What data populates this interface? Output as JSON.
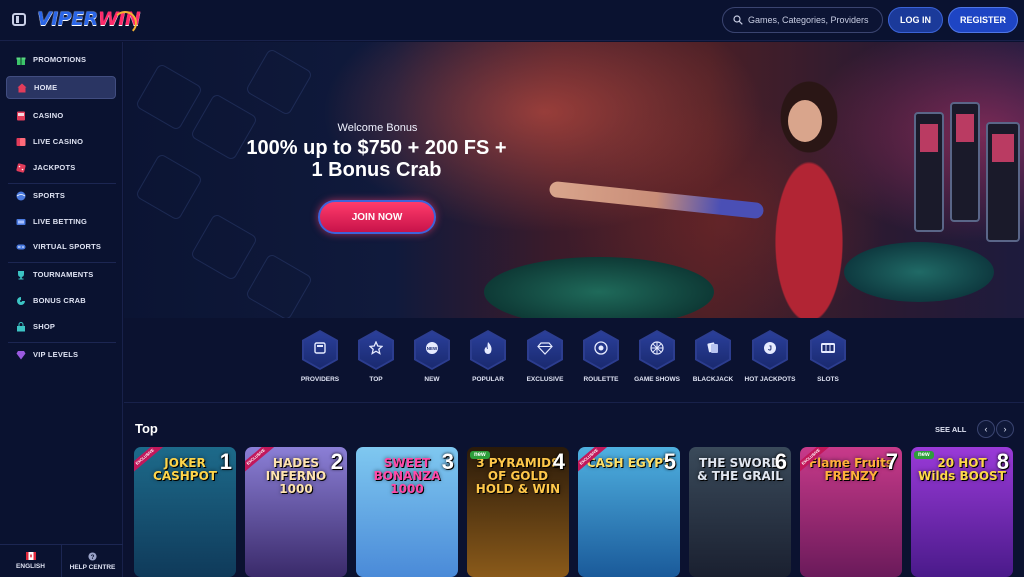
{
  "header": {
    "logo_part1": "VIPER",
    "logo_part2": "WIN",
    "search_placeholder": "Games, Categories, Providers",
    "login_label": "LOG IN",
    "register_label": "REGISTER"
  },
  "sidebar": {
    "items": [
      {
        "label": "PROMOTIONS",
        "icon": "gift-icon"
      },
      {
        "label": "HOME",
        "icon": "home-icon",
        "active": true
      },
      {
        "label": "CASINO",
        "icon": "slot-machine-icon"
      },
      {
        "label": "LIVE CASINO",
        "icon": "cards-icon"
      },
      {
        "label": "JACKPOTS",
        "icon": "dice-icon"
      },
      {
        "label": "SPORTS",
        "icon": "ball-icon"
      },
      {
        "label": "LIVE BETTING",
        "icon": "live-icon"
      },
      {
        "label": "VIRTUAL SPORTS",
        "icon": "gamepad-icon"
      },
      {
        "label": "TOURNAMENTS",
        "icon": "trophy-icon"
      },
      {
        "label": "BONUS CRAB",
        "icon": "crab-icon"
      },
      {
        "label": "SHOP",
        "icon": "shop-icon"
      },
      {
        "label": "VIP LEVELS",
        "icon": "diamond-icon"
      }
    ],
    "language_label": "ENGLISH",
    "help_label": "HELP CENTRE"
  },
  "hero": {
    "subtitle": "Welcome Bonus",
    "title": "100% up to $750 + 200 FS + 1 Bonus Crab",
    "cta_label": "JOIN NOW"
  },
  "categories": [
    {
      "label": "PROVIDERS",
      "icon": "providers-icon"
    },
    {
      "label": "TOP",
      "icon": "star-icon"
    },
    {
      "label": "NEW",
      "icon": "new-icon"
    },
    {
      "label": "POPULAR",
      "icon": "fire-icon"
    },
    {
      "label": "EXCLUSIVE",
      "icon": "diamond-icon"
    },
    {
      "label": "ROULETTE",
      "icon": "roulette-icon"
    },
    {
      "label": "GAME SHOWS",
      "icon": "wheel-icon"
    },
    {
      "label": "BLACKJACK",
      "icon": "blackjack-icon"
    },
    {
      "label": "HOT JACKPOTS",
      "icon": "jackpot-icon"
    },
    {
      "label": "SLOTS",
      "icon": "slots-icon"
    }
  ],
  "top_section": {
    "title": "Top",
    "see_all_label": "SEE ALL",
    "games": [
      {
        "rank": "1",
        "title": "JOKER CASHPOT",
        "ribbon": "EXCLUSIVE",
        "colors": [
          "#1d6a8a",
          "#0f3a5a"
        ],
        "title_color": "#ffd54a"
      },
      {
        "rank": "2",
        "title": "HADES INFERNO 1000",
        "ribbon": "EXCLUSIVE",
        "colors": [
          "#8b7fd6",
          "#3a2a6a"
        ],
        "title_color": "#ffe4b0"
      },
      {
        "rank": "3",
        "title": "SWEET BONANZA 1000",
        "ribbon": "",
        "colors": [
          "#7fc8f0",
          "#4a8ad8"
        ],
        "title_color": "#ff4aa8"
      },
      {
        "rank": "4",
        "title": "3 PYRAMIDS OF GOLD HOLD & WIN",
        "badge": "new",
        "colors": [
          "#2a1a0a",
          "#8a5a1a"
        ],
        "title_color": "#ffc84a"
      },
      {
        "rank": "5",
        "title": "CASH EGYPT",
        "ribbon": "EXCLUSIVE",
        "colors": [
          "#4fb0e0",
          "#1a5a9a"
        ],
        "title_color": "#ffe066"
      },
      {
        "rank": "6",
        "title": "THE SWORD & THE GRAIL",
        "ribbon": "",
        "colors": [
          "#3a4a5a",
          "#1a2030"
        ],
        "title_color": "#e0e6f0"
      },
      {
        "rank": "7",
        "title": "Flame Fruits FRENZY",
        "ribbon": "EXCLUSIVE",
        "colors": [
          "#c83a8a",
          "#6a1a5a"
        ],
        "title_color": "#ffb03a"
      },
      {
        "rank": "8",
        "title": "20 HOT Wilds BOOST",
        "badge": "new",
        "colors": [
          "#9a3ad8",
          "#4a1a8a"
        ],
        "title_color": "#ffd84a"
      }
    ]
  }
}
